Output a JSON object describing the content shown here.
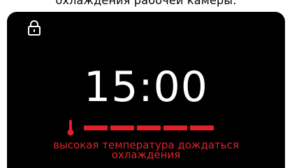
{
  "caption": "охлаждения рабочей камеры.",
  "display": {
    "lock_icon": "lock-icon",
    "time": "15:00",
    "thermometer_icon": "thermometer-icon",
    "temperature_segments_lit": 5,
    "temperature_segments_total": 5,
    "warning_line1": "высокая температура дождаться",
    "warning_line2": "охлаждения"
  },
  "colors": {
    "screen_background": "#000000",
    "time_text": "#ffffff",
    "alert": "#e3202a"
  }
}
